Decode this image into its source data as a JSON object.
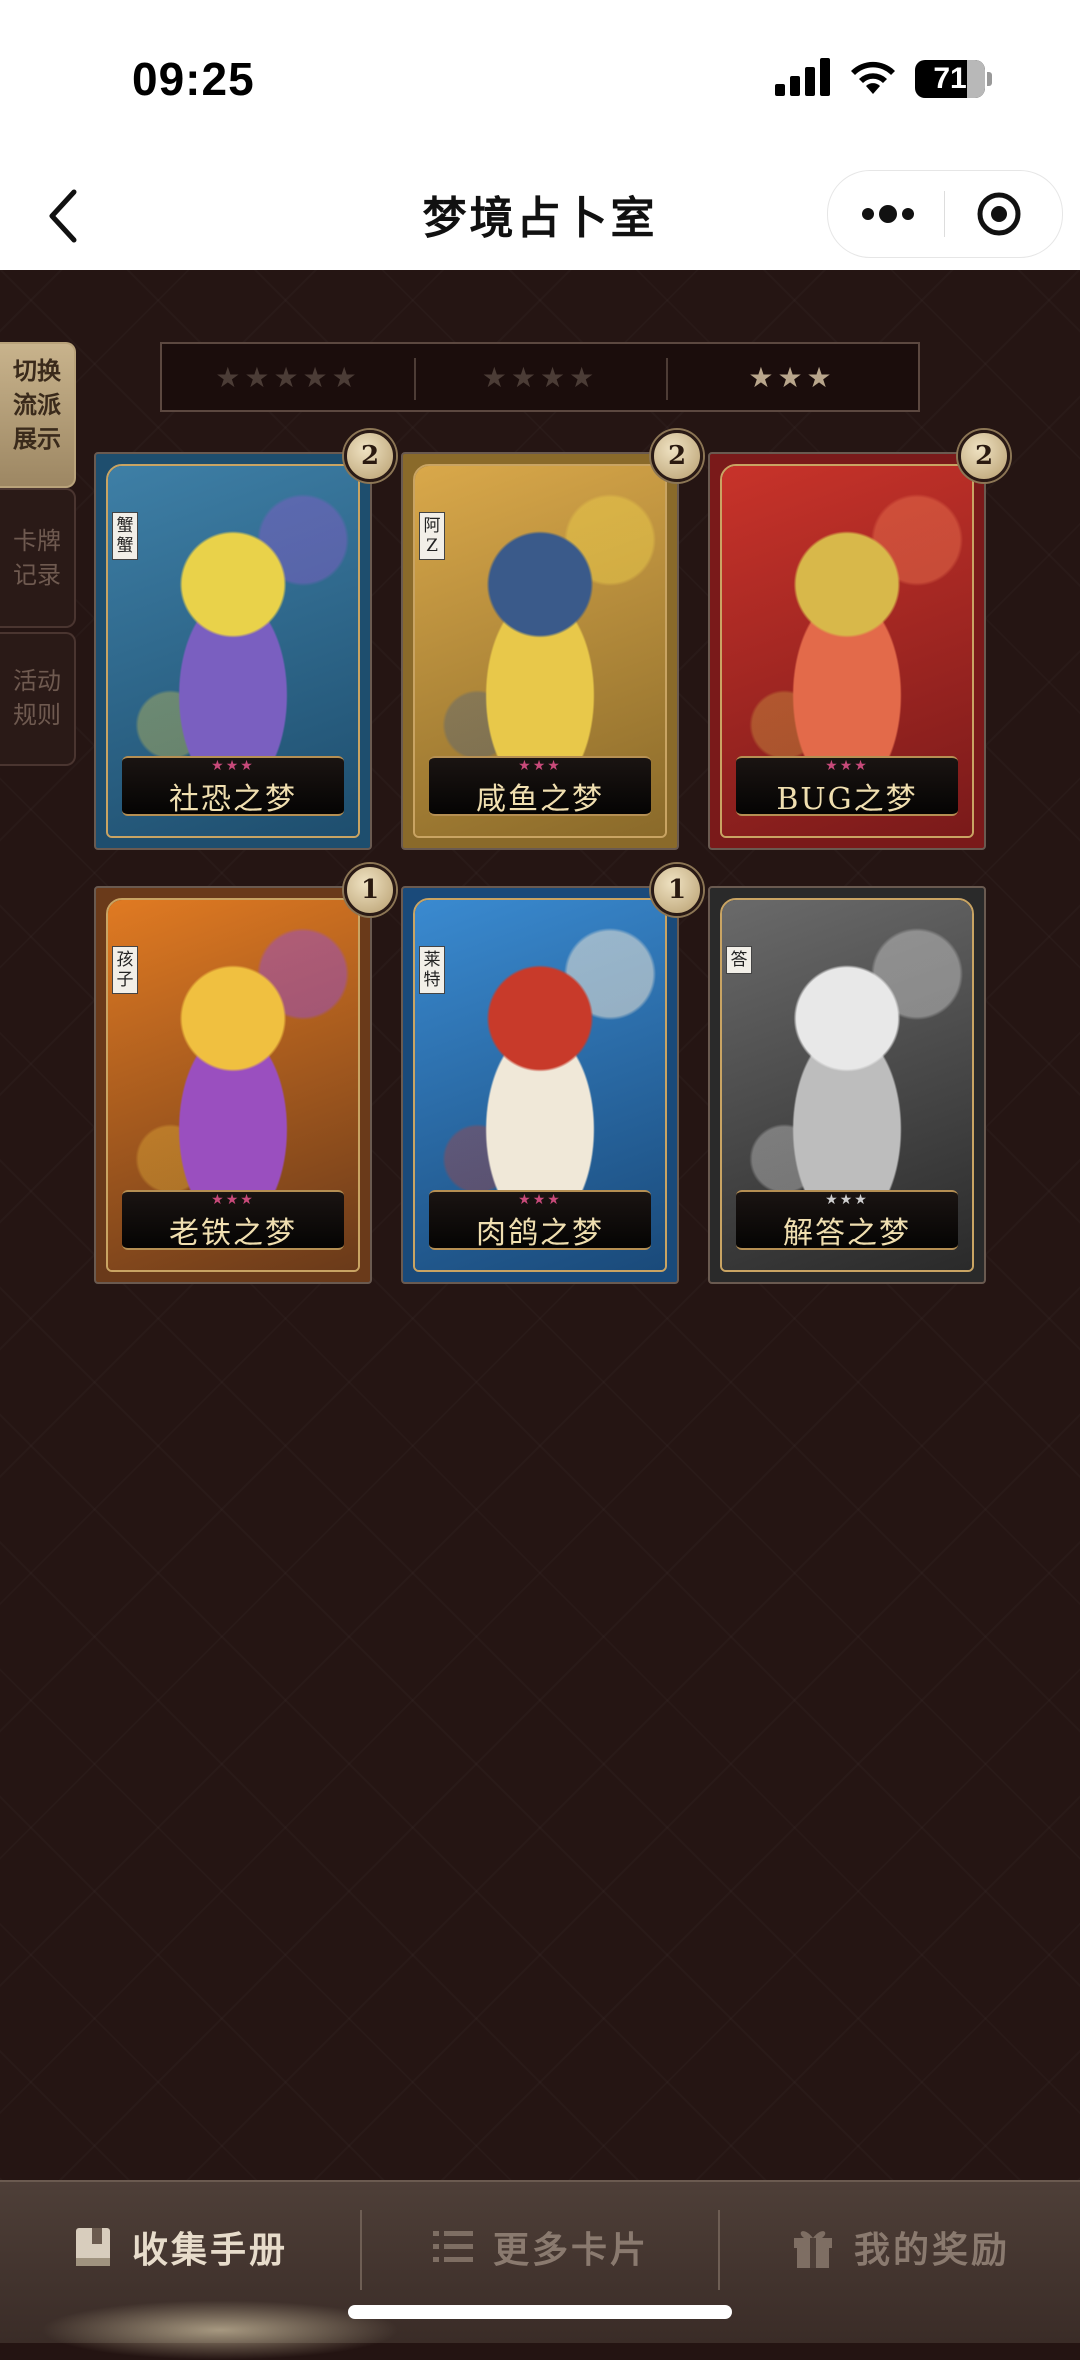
{
  "status_bar": {
    "time": "09:25",
    "battery": "71"
  },
  "nav": {
    "title": "梦境占卜室"
  },
  "side_tabs": [
    {
      "label": "切换流派展示",
      "lines": [
        "切换",
        "流派",
        "展示"
      ],
      "active": true
    },
    {
      "label": "卡牌记录",
      "lines": [
        "卡牌",
        "记录"
      ],
      "active": false
    },
    {
      "label": "活动规则",
      "lines": [
        "活动",
        "规则"
      ],
      "active": false
    }
  ],
  "filters": [
    {
      "label": "★★★★★",
      "active": false
    },
    {
      "label": "★★★★",
      "active": false
    },
    {
      "label": "★★★",
      "active": true
    }
  ],
  "cards": [
    {
      "name": "社恐之梦",
      "stars": "★★★",
      "count": "2",
      "tag": "蟹蟹",
      "palette": [
        "#1e4e6e",
        "#3e7fa6",
        "#7a5fc0",
        "#e9d24a"
      ]
    },
    {
      "name": "咸鱼之梦",
      "stars": "★★★",
      "count": "2",
      "tag": "阿Z",
      "palette": [
        "#8a6a2a",
        "#d9a84a",
        "#e8c84a",
        "#3a5a8a"
      ]
    },
    {
      "name": "BUG之梦",
      "stars": "★★★",
      "count": "2",
      "tag": "",
      "palette": [
        "#7a1a1a",
        "#c8332a",
        "#e36a4a",
        "#d8b84a"
      ]
    },
    {
      "name": "老铁之梦",
      "stars": "★★★",
      "count": "1",
      "tag": "孩子",
      "palette": [
        "#6a3a1a",
        "#e07a22",
        "#9a4fbf",
        "#f0c040"
      ]
    },
    {
      "name": "肉鸽之梦",
      "stars": "★★★",
      "count": "1",
      "tag": "莱特",
      "palette": [
        "#1a4a7a",
        "#3a8ad0",
        "#f0e8d8",
        "#c83a2a"
      ]
    },
    {
      "name": "解答之梦",
      "stars": "★★★",
      "count": "",
      "tag": "答",
      "palette": [
        "#2a2a2a",
        "#6a6a6a",
        "#bdbdbd",
        "#e8e8e8"
      ]
    }
  ],
  "tabbar": [
    {
      "label": "收集手册",
      "icon": "book-icon",
      "active": true
    },
    {
      "label": "更多卡片",
      "icon": "list-icon",
      "active": false
    },
    {
      "label": "我的奖励",
      "icon": "gift-icon",
      "active": false
    }
  ]
}
